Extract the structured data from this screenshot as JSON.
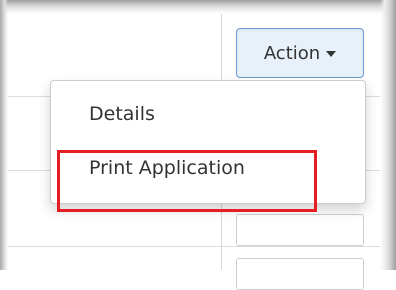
{
  "table": {
    "action_button": {
      "label": "Action",
      "caret_icon": "caret-down-icon"
    }
  },
  "dropdown": {
    "items": [
      {
        "label": "Details"
      },
      {
        "label": "Print Application"
      }
    ]
  },
  "annotation": {
    "highlight_color": "#e41e25"
  },
  "colors": {
    "button_bg": "#e8f0fa",
    "button_border": "#6c9bd2",
    "text": "#333333"
  }
}
